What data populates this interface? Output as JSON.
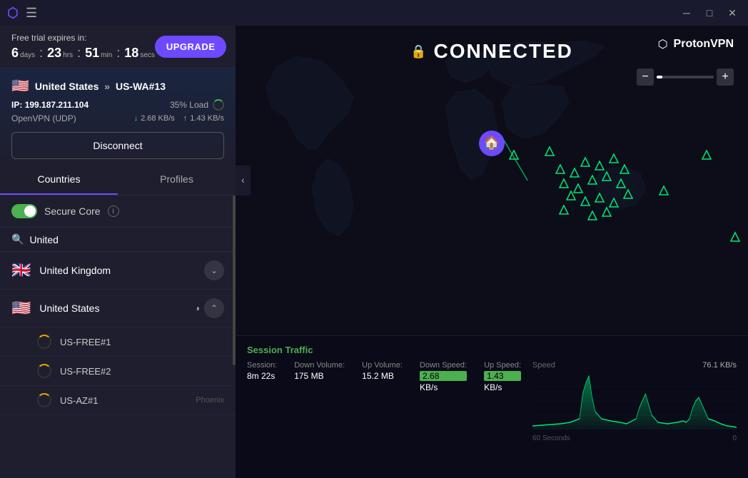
{
  "app": {
    "title": "ProtonVPN"
  },
  "titlebar": {
    "minimize_label": "─",
    "maximize_label": "□",
    "close_label": "✕"
  },
  "trial": {
    "label": "Free trial expires in:",
    "days_num": "6",
    "days_label": "days",
    "hrs_num": "23",
    "hrs_label": "hrs",
    "min_num": "51",
    "min_label": "min",
    "secs_num": "18",
    "secs_label": "secs",
    "upgrade_label": "UPGRADE"
  },
  "connection": {
    "country": "United States",
    "arrow": "»",
    "server": "US-WA#13",
    "ip_label": "IP:",
    "ip": "199.187.211.104",
    "load_label": "35% Load",
    "protocol": "OpenVPN (UDP)",
    "down_speed": "2.68 KB/s",
    "up_speed": "1.43 KB/s",
    "disconnect_label": "Disconnect"
  },
  "tabs": {
    "countries": "Countries",
    "profiles": "Profiles"
  },
  "secure_core": {
    "label": "Secure Core",
    "info_label": "i"
  },
  "search": {
    "placeholder": "United"
  },
  "countries": [
    {
      "flag": "🇬🇧",
      "name": "United Kingdom",
      "expanded": false
    },
    {
      "flag": "🇺🇸",
      "name": "United States",
      "expanded": true
    }
  ],
  "servers": [
    {
      "name": "US-FREE#1"
    },
    {
      "name": "US-FREE#2"
    },
    {
      "name": "US-AZ#1",
      "location": "Phoenix"
    }
  ],
  "map": {
    "connected_label": "CONNECTED",
    "brand_label": "ProtonVPN"
  },
  "zoom": {
    "minus_label": "−",
    "plus_label": "+"
  },
  "graph": {
    "title": "Session Traffic",
    "session_label": "Session:",
    "session_value": "8m 22s",
    "down_volume_label": "Down Volume:",
    "down_volume_value": "175",
    "down_volume_unit": "MB",
    "up_volume_label": "Up Volume:",
    "up_volume_value": "15.2",
    "up_volume_unit": "MB",
    "down_speed_label": "Down Speed:",
    "down_speed_value": "2.68",
    "down_speed_unit": "KB/s",
    "up_speed_label": "Up Speed:",
    "up_speed_value": "1.43",
    "up_speed_unit": "KB/s",
    "speed_axis_label": "Speed",
    "speed_axis_value": "76.1  KB/s",
    "time_axis_left": "60 Seconds",
    "time_axis_right": "0"
  }
}
